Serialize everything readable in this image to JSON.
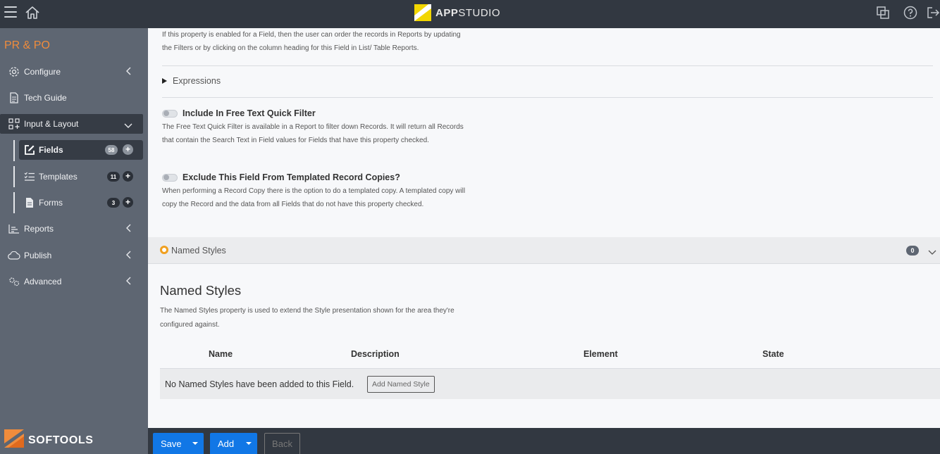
{
  "app": {
    "brand_bold": "APP",
    "brand_thin": "STUDIO",
    "title": "PR & PO"
  },
  "sidebar": {
    "items": [
      {
        "label": "Configure",
        "icon": "gear-icon"
      },
      {
        "label": "Tech Guide",
        "icon": "document-icon"
      },
      {
        "label": "Input & Layout",
        "icon": "layout-icon"
      },
      {
        "label": "Reports",
        "icon": "chart-icon"
      },
      {
        "label": "Publish",
        "icon": "cloud-icon"
      },
      {
        "label": "Advanced",
        "icon": "gears-icon"
      }
    ],
    "sub_items": [
      {
        "label": "Fields",
        "count": "58",
        "icon": "edit-icon"
      },
      {
        "label": "Templates",
        "count": "11",
        "icon": "checklist-icon"
      },
      {
        "label": "Forms",
        "count": "3",
        "icon": "file-icon"
      }
    ],
    "footer_brand": "SOFTOOLS"
  },
  "content": {
    "ordering_desc": "If this property is enabled for a Field, then the user can order the records in Reports by updating the Filters or by clicking on the column heading for this Field in List/ Table Reports.",
    "expressions_label": "Expressions",
    "free_text": {
      "label": "Include In Free Text Quick Filter",
      "desc": "The Free Text Quick Filter is available in a Report to filter down Records. It will return all Records that contain the Search Text in Field values for Fields that have this property checked."
    },
    "exclude_copy": {
      "label": "Exclude This Field From Templated Record Copies?",
      "desc": "When performing a Record Copy there is the option to do a templated copy. A templated copy will copy the Record and the data from all Fields that do not have this property checked."
    },
    "named_styles_section": {
      "label": "Named Styles",
      "count": "0"
    },
    "named_styles": {
      "title": "Named Styles",
      "desc": "The Named Styles property is used to extend the Style presentation shown for the area they're configured against.",
      "columns": [
        "Name",
        "Description",
        "Element",
        "State"
      ],
      "empty_message": "No Named Styles have been added to this Field.",
      "add_button": "Add Named Style"
    }
  },
  "footer": {
    "save": "Save",
    "add": "Add",
    "back": "Back"
  },
  "colors": {
    "topbar": "#323841",
    "sidebar": "#5e6672",
    "accent_orange": "#f08c3c",
    "primary_blue": "#1177e6"
  }
}
